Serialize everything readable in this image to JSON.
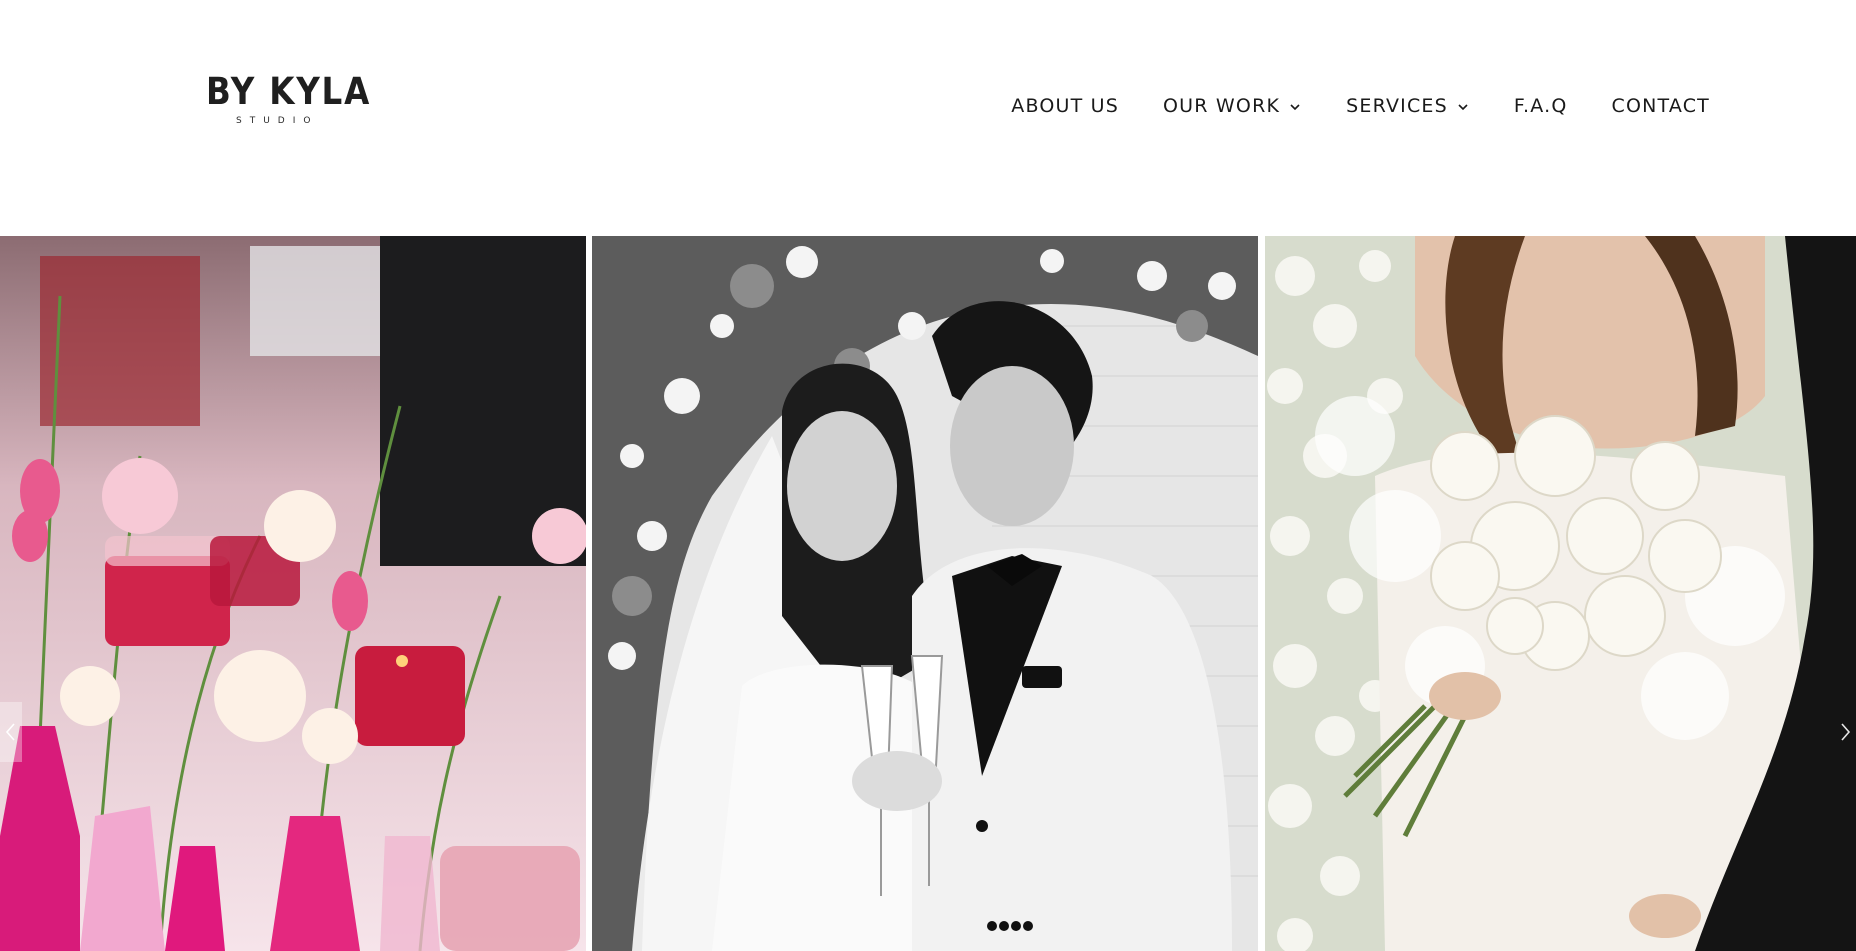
{
  "brand": {
    "name": "BY KYLA",
    "tagline": "STUDIO"
  },
  "nav": {
    "items": [
      {
        "label": "ABOUT US",
        "has_dropdown": false
      },
      {
        "label": "OUR WORK",
        "has_dropdown": true
      },
      {
        "label": "SERVICES",
        "has_dropdown": true
      },
      {
        "label": "F.A.Q",
        "has_dropdown": false
      },
      {
        "label": "CONTACT",
        "has_dropdown": false
      }
    ]
  },
  "gallery": {
    "slides": [
      {
        "subject": "pink table flowers and candles"
      },
      {
        "subject": "black and white couple with champagne"
      },
      {
        "subject": "bride holding white rose bouquet"
      }
    ],
    "prev_icon": "chevron-left-icon",
    "next_icon": "chevron-right-icon"
  },
  "colors": {
    "text": "#1a1a1a",
    "background": "#ffffff",
    "accent_pink": "#d81b60"
  }
}
